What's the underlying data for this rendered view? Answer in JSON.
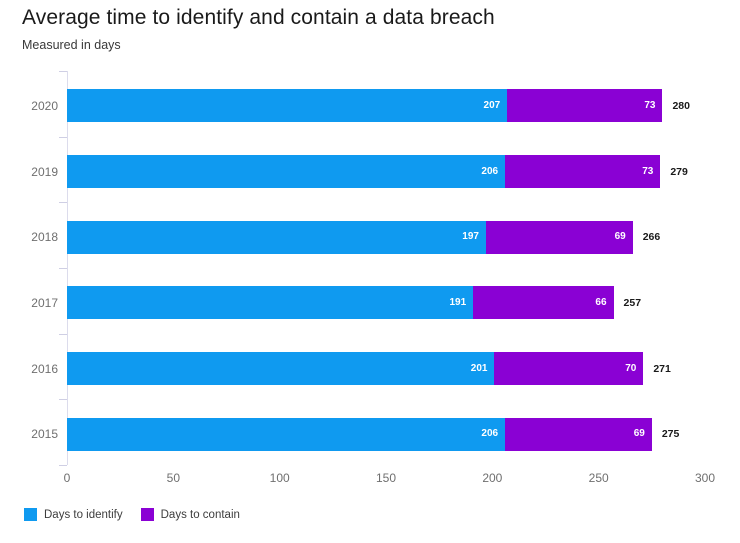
{
  "chart_data": {
    "type": "bar",
    "orientation": "horizontal",
    "stacked": true,
    "title": "Average time to identify and contain a data breach",
    "subtitle": "Measured in days",
    "xlabel": "",
    "ylabel": "",
    "xlim": [
      0,
      300
    ],
    "xticks": [
      0,
      50,
      100,
      150,
      200,
      250,
      300
    ],
    "grid": false,
    "legend_position": "bottom-left",
    "categories": [
      "2020",
      "2019",
      "2018",
      "2017",
      "2016",
      "2015"
    ],
    "series": [
      {
        "name": "Days to identify",
        "color": "#0f9af0",
        "values": [
          207,
          206,
          197,
          191,
          201,
          206
        ]
      },
      {
        "name": "Days to contain",
        "color": "#8a01d4",
        "values": [
          73,
          73,
          69,
          66,
          70,
          69
        ]
      }
    ],
    "totals": [
      280,
      279,
      266,
      257,
      271,
      275
    ],
    "total_label_color": "#1a1a1a",
    "axis_color": "#dcdcec",
    "tick_label_color": "#6f6f6f"
  },
  "legend": {
    "items": [
      {
        "label": "Days to identify",
        "color": "#0f9af0"
      },
      {
        "label": "Days to contain",
        "color": "#8a01d4"
      }
    ]
  }
}
